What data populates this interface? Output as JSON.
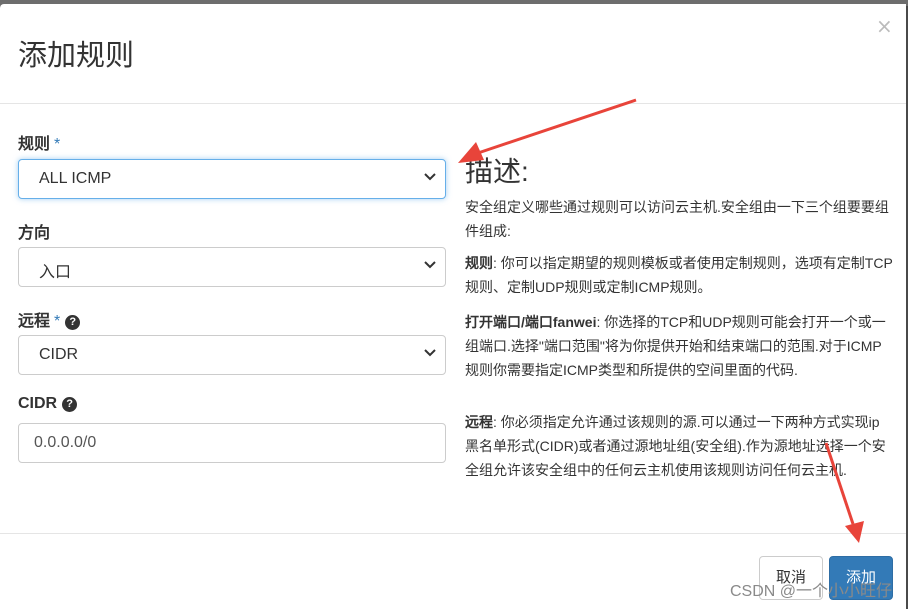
{
  "dialog": {
    "title": "添加规则",
    "close_glyph": "×"
  },
  "form": {
    "rule": {
      "label": "规则",
      "required_mark": "*",
      "value": "ALL ICMP"
    },
    "direction": {
      "label": "方向",
      "value": "入口"
    },
    "remote": {
      "label": "远程",
      "required_mark": "*",
      "value": "CIDR",
      "help_icon": "question-circle-icon"
    },
    "cidr": {
      "label": "CIDR",
      "value": "0.0.0.0/0",
      "help_icon": "question-circle-icon"
    }
  },
  "description": {
    "heading": "描述:",
    "intro": "安全组定义哪些通过规则可以访问云主机.安全组由一下三个组要要组件组成:",
    "rule_term": "规则",
    "rule_text": ": 你可以指定期望的规则模板或者使用定制规则，选项有定制TCP规则、定制UDP规则或定制ICMP规则。",
    "port_term": "打开端口/端口fanwei",
    "port_text": ": 你选择的TCP和UDP规则可能会打开一个或一组端口.选择\"端口范围\"将为你提供开始和结束端口的范围.对于ICMP规则你需要指定ICMP类型和所提供的空间里面的代码.",
    "remote_term": "远程",
    "remote_text": ": 你必须指定允许通过该规则的源.可以通过一下两种方式实现ip黑名单形式(CIDR)或者通过源地址组(安全组).作为源地址选择一个安全组允许该安全组中的任何云主机使用该规则访问任何云主机."
  },
  "footer": {
    "cancel_label": "取消",
    "add_label": "添加"
  },
  "watermark": "CSDN @一个小小旺仔",
  "colors": {
    "primary": "#337ab7",
    "annotation_arrow": "#e8443a",
    "focus_border": "#66afe9"
  }
}
